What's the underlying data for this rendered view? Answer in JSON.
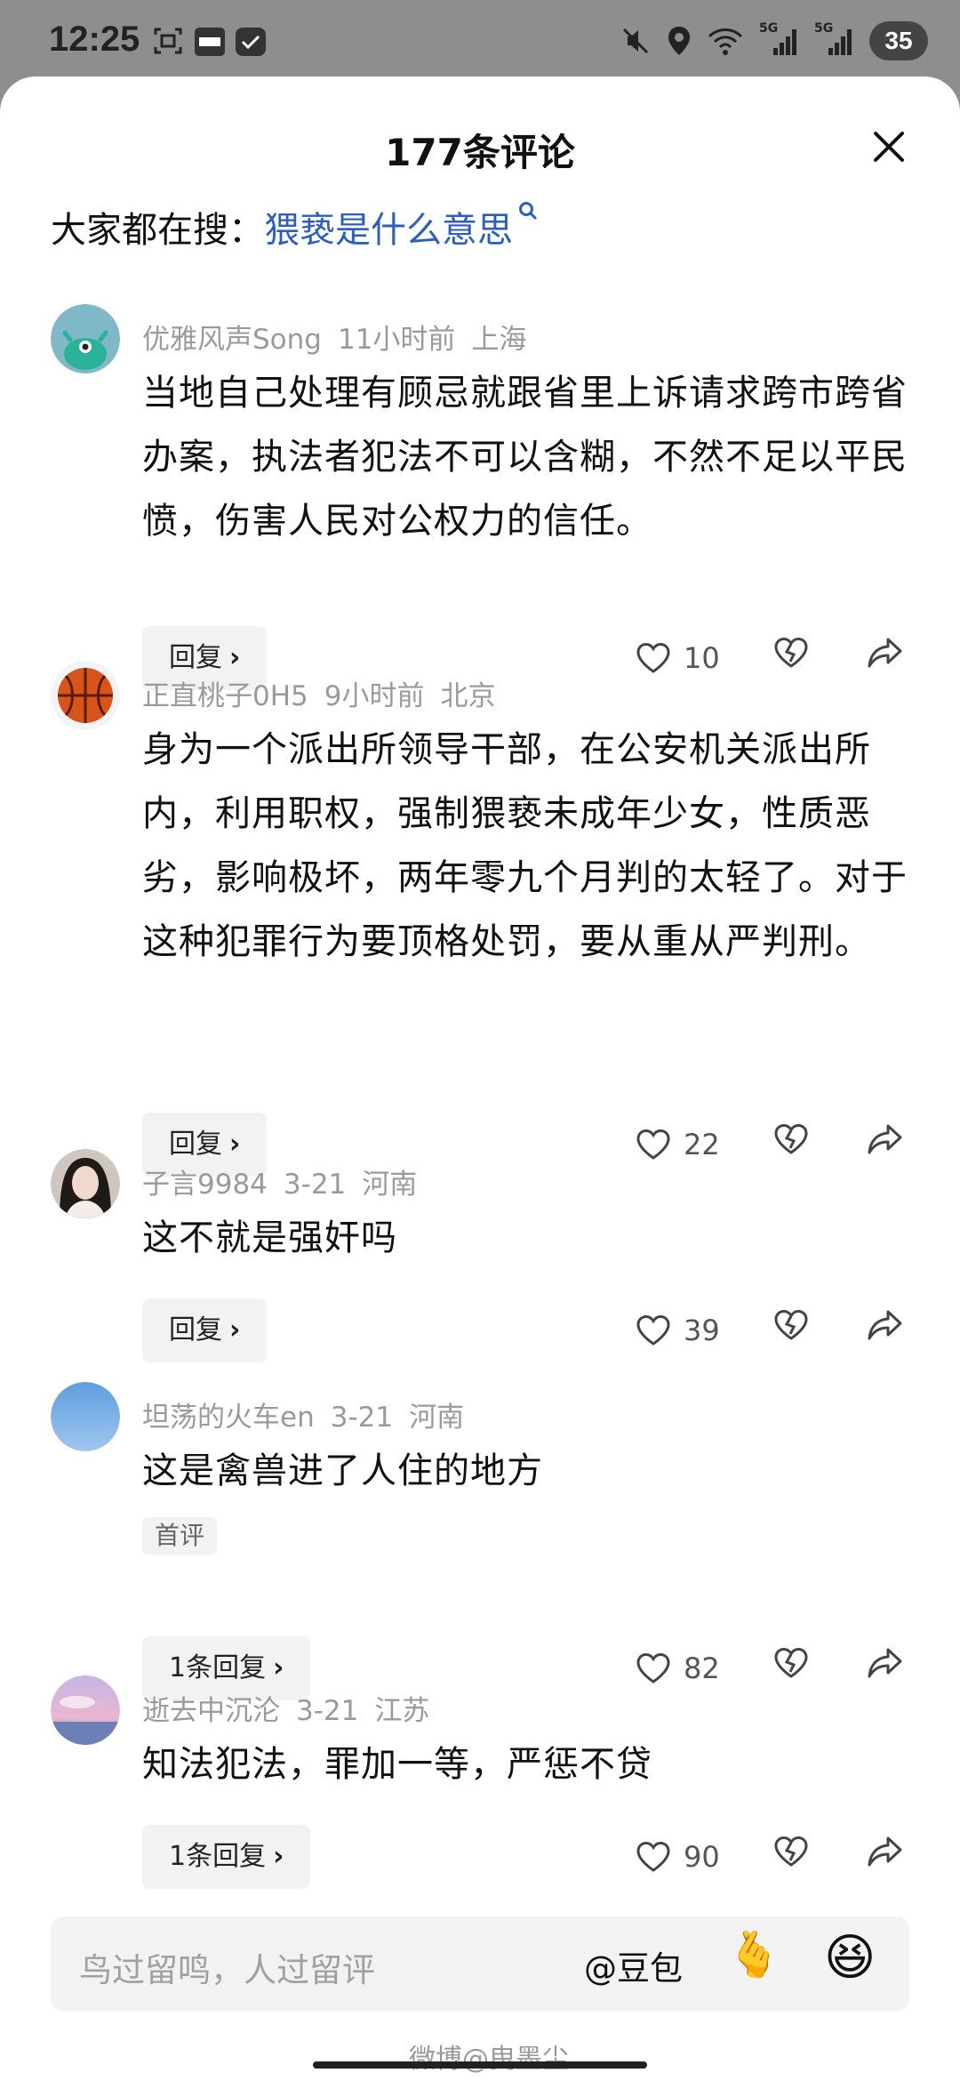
{
  "status_bar": {
    "time": "12:25",
    "battery": "35",
    "signal_labels": [
      "5G",
      "5G"
    ]
  },
  "header": {
    "title": "177条评论"
  },
  "trending": {
    "prefix": "大家都在搜：",
    "query": "猥亵是什么意思"
  },
  "comments": [
    {
      "user": "优雅风声Song",
      "time": "11小时前",
      "location": "上海",
      "text": "当地自己处理有顾忌就跟省里上诉请求跨市跨省办案，执法者犯法不可以含糊，不然不足以平民愤，伤害人民对公权力的信任。",
      "reply_label": "回复",
      "likes": "10"
    },
    {
      "user": "正直桃子0H5",
      "time": "9小时前",
      "location": "北京",
      "text": "身为一个派出所领导干部，在公安机关派出所内，利用职权，强制猥亵未成年少女，性质恶劣，影响极坏，两年零九个月判的太轻了。对于这种犯罪行为要顶格处罚，要从重从严判刑。",
      "reply_label": "回复",
      "likes": "22"
    },
    {
      "user": "子言9984",
      "time": "3-21",
      "location": "河南",
      "text": "这不就是强奸吗",
      "reply_label": "回复",
      "likes": "39"
    },
    {
      "user": "坦荡的火车en",
      "time": "3-21",
      "location": "河南",
      "text": "这是禽兽进了人住的地方",
      "tag": "首评",
      "reply_label": "1条回复",
      "likes": "82"
    },
    {
      "user": "逝去中沉沦",
      "time": "3-21",
      "location": "江苏",
      "text": "知法犯法，罪加一等，严惩不贷",
      "reply_label": "1条回复",
      "likes": "90"
    }
  ],
  "input_bar": {
    "placeholder": "鸟过留鸣，人过留评",
    "mention": "@豆包"
  },
  "watermark": "微博@曳墨尘",
  "colors": {
    "link": "#2a5fbf",
    "meta_gray": "#9a9a9a",
    "button_bg": "#f2f2f2"
  }
}
